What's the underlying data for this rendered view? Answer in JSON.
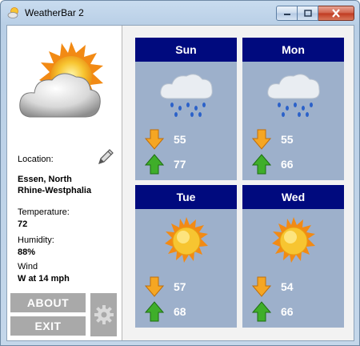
{
  "window": {
    "title": "WeatherBar 2"
  },
  "current": {
    "location_label": "Location:",
    "location_value": "Essen, North Rhine-Westphalia",
    "location_line1": "Essen, North",
    "location_line2": "Rhine-Westphalia",
    "temperature_label": "Temperature:",
    "temperature_value": "72",
    "humidity_label": "Humidity:",
    "humidity_value": "88%",
    "wind_label": "Wind",
    "wind_value": "W at 14 mph",
    "condition_icon": "partly-cloudy-icon"
  },
  "buttons": {
    "about": "ABOUT",
    "exit": "EXIT",
    "settings_icon": "gear-icon"
  },
  "forecast": [
    {
      "day": "Sun",
      "icon": "rain-icon",
      "low": "55",
      "high": "77"
    },
    {
      "day": "Mon",
      "icon": "rain-icon",
      "low": "55",
      "high": "66"
    },
    {
      "day": "Tue",
      "icon": "sunny-icon",
      "low": "57",
      "high": "68"
    },
    {
      "day": "Wed",
      "icon": "sunny-icon",
      "low": "54",
      "high": "66"
    }
  ],
  "colors": {
    "day_header": "#000a7e",
    "day_body": "#9db0cb",
    "button_gray": "#a9a9a9",
    "low_arrow": "#f5a623",
    "high_arrow": "#3fae2a"
  }
}
